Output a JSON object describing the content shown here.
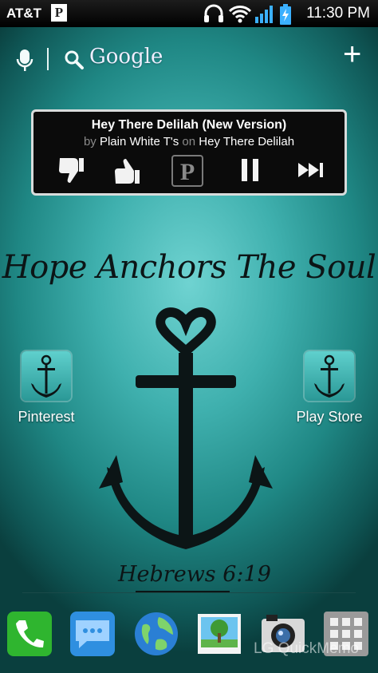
{
  "status_bar": {
    "carrier": "AT&T",
    "notification_letter": "P",
    "time": "11:30 PM"
  },
  "search_bar": {
    "label": "Google",
    "mic_icon": "microphone-icon",
    "search_icon": "search-icon",
    "add_icon": "plus-icon"
  },
  "music_widget": {
    "title": "Hey There Delilah (New Version)",
    "by_word": "by",
    "artist": "Plain White T's",
    "on_word": "on",
    "album": "Hey There Delilah",
    "pandora_letter": "P",
    "buttons": [
      "thumbs-down-icon",
      "thumbs-up-icon",
      "pandora-icon",
      "pause-icon",
      "skip-icon"
    ]
  },
  "wallpaper": {
    "headline": "Hope Anchors The Soul",
    "verse": "Hebrews 6:19"
  },
  "shortcuts": [
    {
      "label": "Pinterest",
      "icon": "anchor-icon"
    },
    {
      "label": "Play Store",
      "icon": "anchor-icon"
    }
  ],
  "dock": {
    "apps": [
      "phone-icon",
      "messaging-icon",
      "browser-icon",
      "gallery-icon",
      "camera-icon",
      "app-drawer-icon"
    ],
    "watermark": "LG QuickMemo"
  },
  "colors": {
    "wallpaper_center": "#6fd3d1",
    "wallpaper_edge": "#0a3f3e",
    "widget_bg": "#0b0b0b"
  }
}
